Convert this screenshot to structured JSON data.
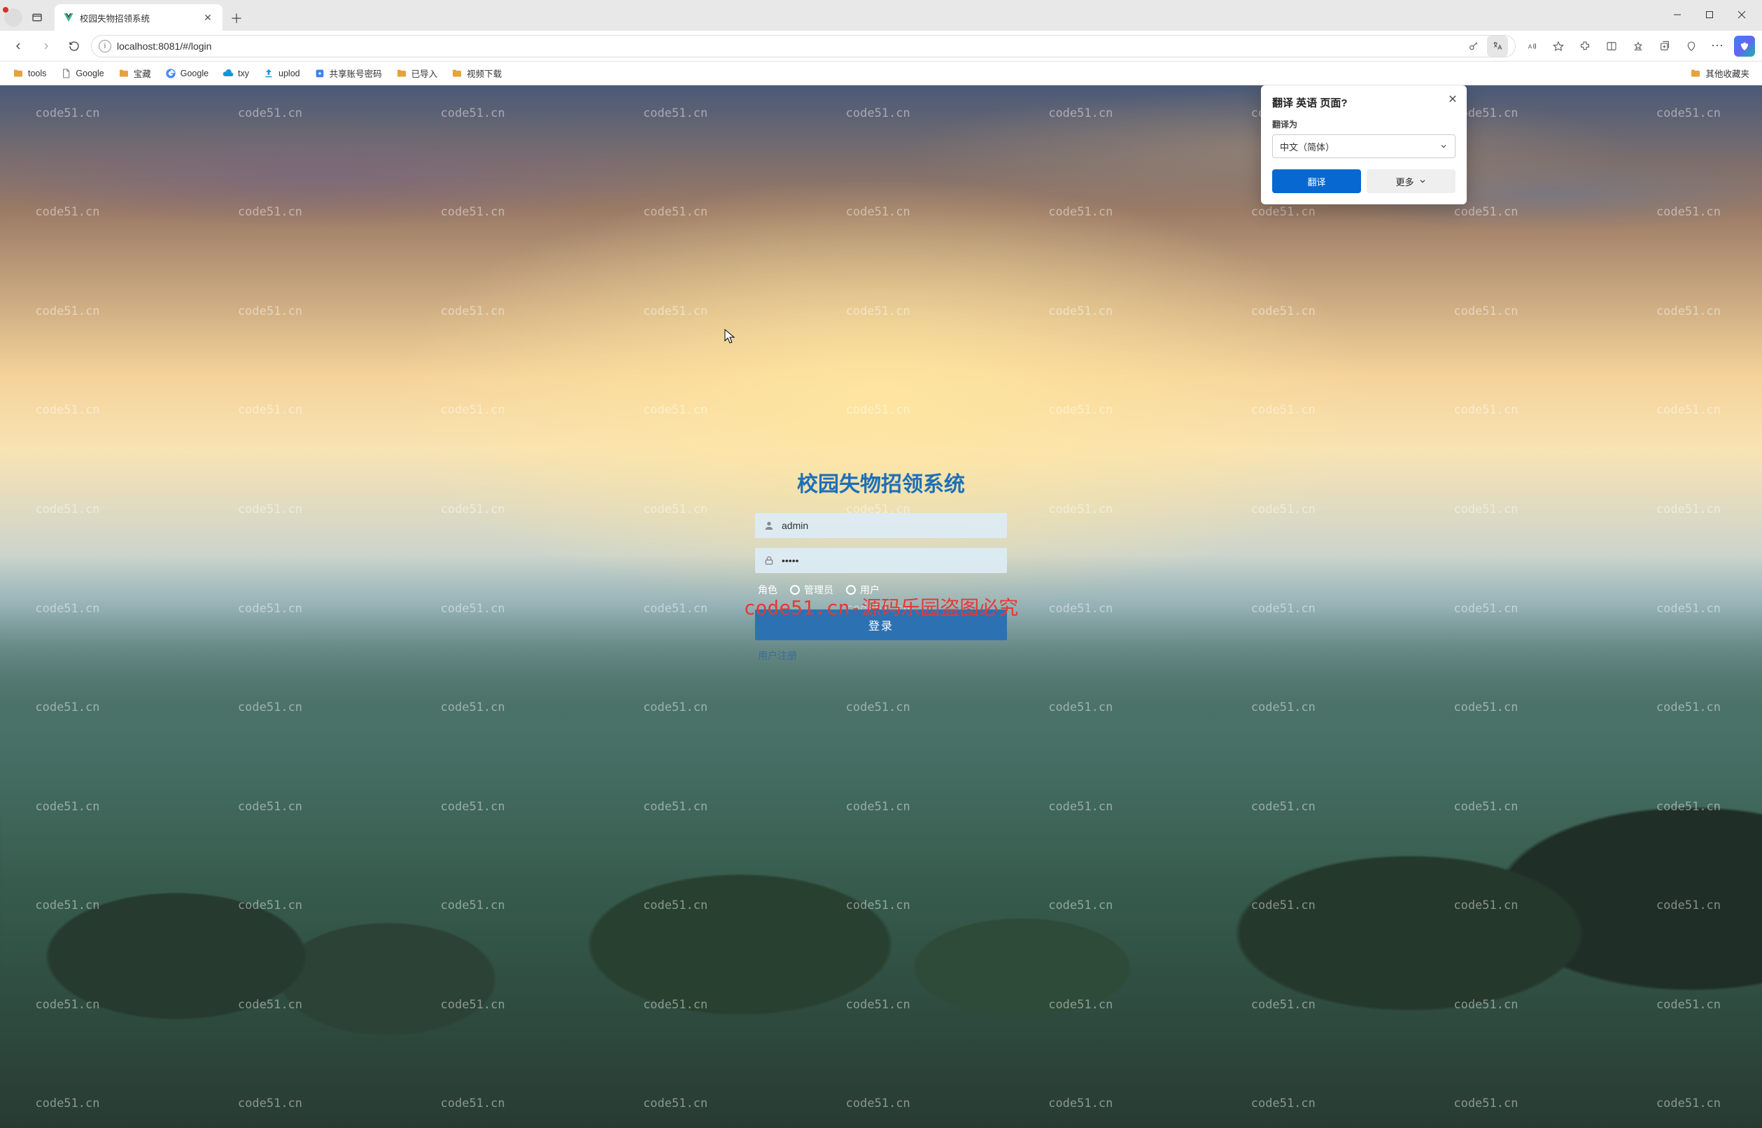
{
  "browser": {
    "tab_title": "校园失物招领系统",
    "url_display": "localhost:8081/#/login",
    "bookmarks": [
      {
        "label": "tools",
        "icon": "folder"
      },
      {
        "label": "Google",
        "icon": "page"
      },
      {
        "label": "宝藏",
        "icon": "folder"
      },
      {
        "label": "Google",
        "icon": "google"
      },
      {
        "label": "txy",
        "icon": "cloud"
      },
      {
        "label": "uplod",
        "icon": "upload"
      },
      {
        "label": "共享账号密码",
        "icon": "share"
      },
      {
        "label": "已导入",
        "icon": "folder"
      },
      {
        "label": "视频下载",
        "icon": "folder"
      }
    ],
    "other_bookmarks_label": "其他收藏夹"
  },
  "translate_popover": {
    "title": "翻译 英语 页面?",
    "sub_label": "翻译为",
    "selected_language": "中文（简体）",
    "primary_btn": "翻译",
    "secondary_btn": "更多"
  },
  "login": {
    "title": "校园失物招领系统",
    "username_value": "admin",
    "password_value": "•••••",
    "role_label": "角色",
    "role_admin": "管理员",
    "role_user": "用户",
    "login_btn": "登录",
    "register_link": "用户注册"
  },
  "watermark": {
    "label": "code51.cn",
    "center_text": "code51.cn-源码乐园盗图必究"
  }
}
